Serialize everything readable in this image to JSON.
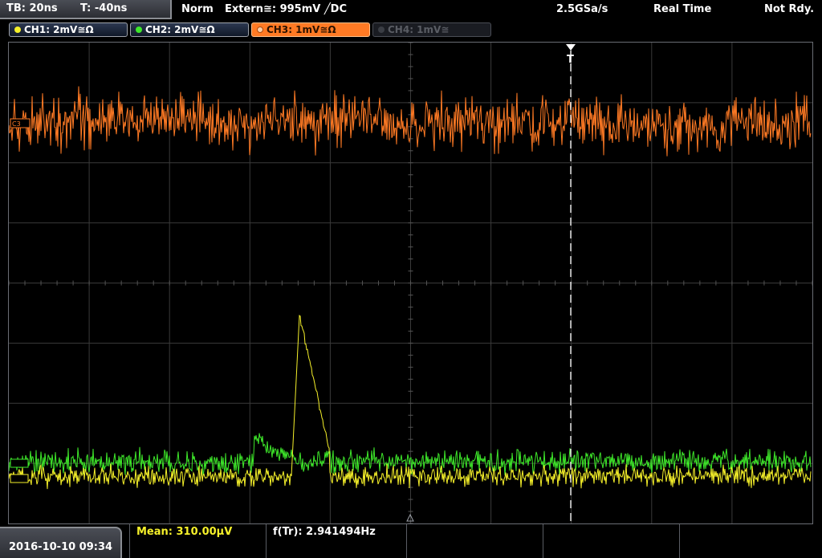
{
  "timebase": {
    "tb": "TB: 20ns",
    "trigger_offset": "T: -40ns"
  },
  "status": {
    "mode": "Norm",
    "trigger": "Extern≅: 995mV ╱DC",
    "sample_rate": "2.5GSa/s",
    "acq_mode": "Real Time",
    "ready": "Not Rdy."
  },
  "channels": [
    {
      "label": "CH1: 2mV≅Ω",
      "color": "#f5f02a",
      "state": "on"
    },
    {
      "label": "CH2: 2mV≅Ω",
      "color": "#3ee82a",
      "state": "on"
    },
    {
      "label": "CH3: 1mV≅Ω",
      "color": "#ff7a24",
      "state": "active"
    },
    {
      "label": "CH4: 1mV≅",
      "color": "#5a5d64",
      "state": "off"
    }
  ],
  "markers": {
    "ch3": "C3",
    "trigger": "T"
  },
  "measurements": {
    "mean": "Mean: 310.00µV",
    "freq": "f(Tr): 2.941494Hz"
  },
  "datetime": "2016-10-10 09:34",
  "colors": {
    "ch1": "#f5f02a",
    "ch2": "#3ee82a",
    "ch3": "#ff7a24",
    "grid": "#3a3a3a"
  }
}
